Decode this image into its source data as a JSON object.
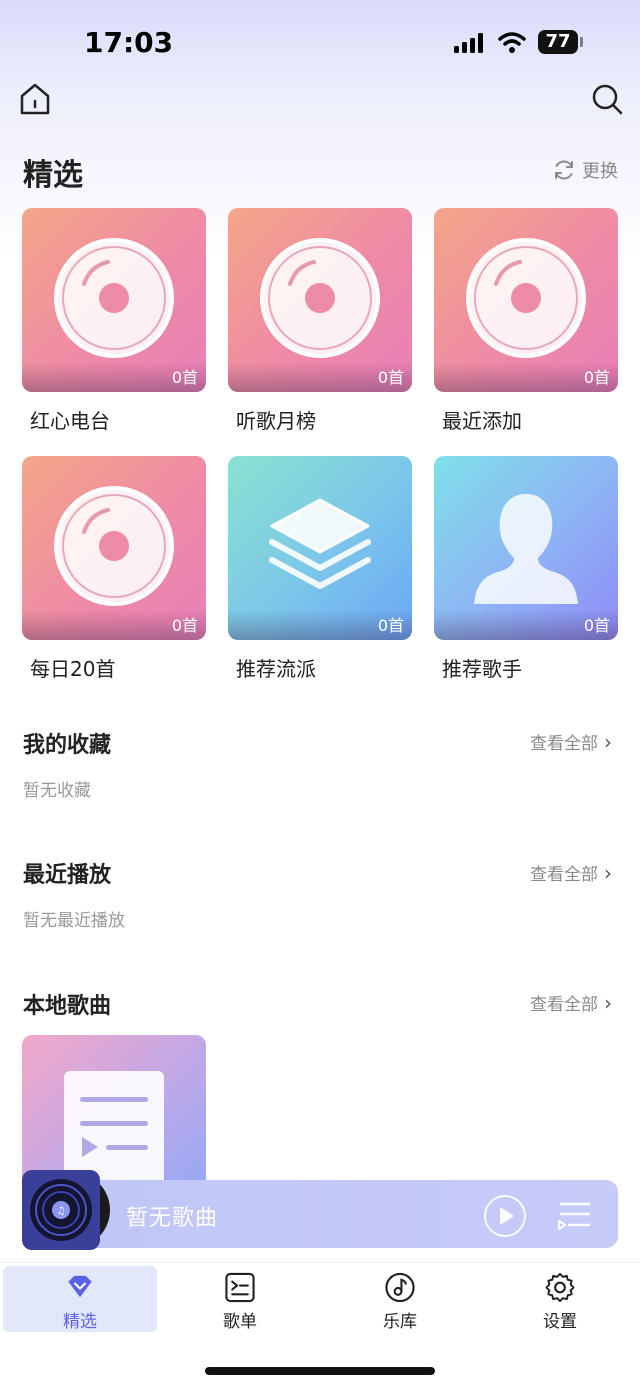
{
  "status_bar": {
    "time": "17:03",
    "battery": "77"
  },
  "header": {
    "home_icon": "home-icon",
    "search_icon": "search-icon"
  },
  "featured": {
    "title": "精选",
    "refresh_label": "更换",
    "cards": [
      {
        "label": "红心电台",
        "count": "0首",
        "art": "disc-icon"
      },
      {
        "label": "听歌月榜",
        "count": "0首",
        "art": "disc-icon"
      },
      {
        "label": "最近添加",
        "count": "0首",
        "art": "disc-icon"
      },
      {
        "label": "每日20首",
        "count": "0首",
        "art": "disc-icon"
      },
      {
        "label": "推荐流派",
        "count": "0首",
        "art": "layers-icon"
      },
      {
        "label": "推荐歌手",
        "count": "0首",
        "art": "person-icon"
      }
    ]
  },
  "favorites": {
    "title": "我的收藏",
    "see_all": "查看全部",
    "empty": "暂无收藏"
  },
  "recent": {
    "title": "最近播放",
    "see_all": "查看全部",
    "empty": "暂无最近播放"
  },
  "local": {
    "title": "本地歌曲",
    "see_all": "查看全部"
  },
  "player": {
    "title": "暂无歌曲"
  },
  "tabs": [
    {
      "label": "精选",
      "icon": "diamond-icon",
      "active": true
    },
    {
      "label": "歌单",
      "icon": "playlist-icon",
      "active": false
    },
    {
      "label": "乐库",
      "icon": "music-disc-icon",
      "active": false
    },
    {
      "label": "设置",
      "icon": "gear-icon",
      "active": false
    }
  ],
  "colors": {
    "accent": "#5a63e8",
    "tab_active_bg": "#e2e7fb",
    "player_bg": "#c3c8f7"
  }
}
